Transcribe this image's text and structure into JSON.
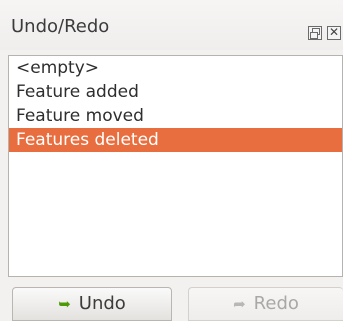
{
  "panel": {
    "title": "Undo/Redo",
    "float_icon": "float-window-icon",
    "close_icon": "close-icon",
    "close_glyph": "✕"
  },
  "history": {
    "items": [
      {
        "label": "<empty>",
        "selected": false
      },
      {
        "label": "Feature added",
        "selected": false
      },
      {
        "label": "Feature moved",
        "selected": false
      },
      {
        "label": "Features deleted",
        "selected": true
      }
    ],
    "selected_color": "#e96e3f"
  },
  "buttons": {
    "undo": {
      "label": "Undo",
      "icon": "undo-arrow-icon",
      "glyph": "➥",
      "enabled": true,
      "icon_color": "#4e9a06"
    },
    "redo": {
      "label": "Redo",
      "icon": "redo-arrow-icon",
      "glyph": "➦",
      "enabled": false
    }
  }
}
